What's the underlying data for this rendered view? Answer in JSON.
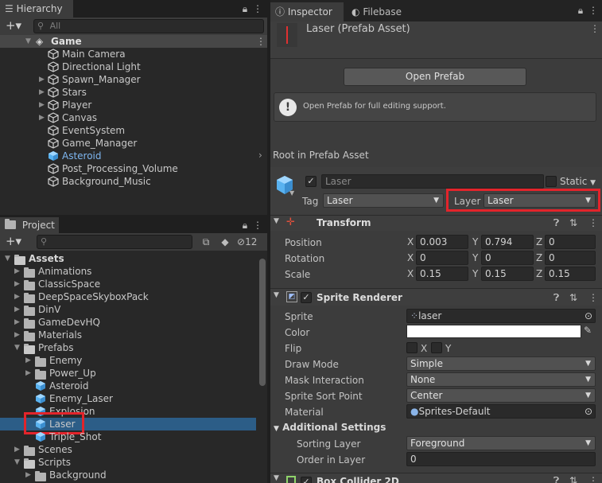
{
  "hierarchy": {
    "tab_label": "Hierarchy",
    "search_placeholder": "All",
    "scene_name": "Game",
    "items": [
      {
        "label": "Main Camera"
      },
      {
        "label": "Directional Light"
      },
      {
        "label": "Spawn_Manager"
      },
      {
        "label": "Stars"
      },
      {
        "label": "Player"
      },
      {
        "label": "Canvas"
      },
      {
        "label": "EventSystem"
      },
      {
        "label": "Game_Manager"
      },
      {
        "label": "Asteroid"
      },
      {
        "label": "Post_Processing_Volume"
      },
      {
        "label": "Background_Music"
      }
    ]
  },
  "project": {
    "tab_label": "Project",
    "hidden_count": "12",
    "root": "Assets",
    "folders": [
      "Animations",
      "ClassicSpace",
      "DeepSpaceSkyboxPack",
      "DinV",
      "GameDevHQ",
      "Materials",
      "Prefabs"
    ],
    "prefab_children": [
      "Enemy",
      "Power_Up",
      "Asteroid",
      "Enemy_Laser",
      "Explosion",
      "Laser",
      "Triple_Shot"
    ],
    "after": [
      "Scenes",
      "Scripts",
      "Background"
    ]
  },
  "inspector": {
    "tab_label": "Inspector",
    "tab2_label": "Filebase",
    "asset_title": "Laser (Prefab Asset)",
    "open_prefab_label": "Open Prefab",
    "info_text": "Open Prefab for full editing support.",
    "root_label": "Root in Prefab Asset",
    "object_name": "Laser",
    "static_label": "Static",
    "tag_label": "Tag",
    "tag_value": "Laser",
    "layer_label": "Layer",
    "layer_value": "Laser",
    "transform": {
      "title": "Transform",
      "position_label": "Position",
      "rotation_label": "Rotation",
      "scale_label": "Scale",
      "position": [
        "0.003",
        "0.794",
        "0"
      ],
      "rotation": [
        "0",
        "0",
        "0"
      ],
      "scale": [
        "0.15",
        "0.15",
        "0.15"
      ],
      "axes": [
        "X",
        "Y",
        "Z"
      ]
    },
    "sprite_renderer": {
      "title": "Sprite Renderer",
      "sprite_label": "Sprite",
      "sprite_value": "laser",
      "color_label": "Color",
      "color_value": "#ffffff",
      "flip_label": "Flip",
      "flip_x": "X",
      "flip_y": "Y",
      "draw_mode_label": "Draw Mode",
      "draw_mode_value": "Simple",
      "mask_label": "Mask Interaction",
      "mask_value": "None",
      "sort_point_label": "Sprite Sort Point",
      "sort_point_value": "Center",
      "material_label": "Material",
      "material_value": "Sprites-Default",
      "additional_label": "Additional Settings",
      "sorting_layer_label": "Sorting Layer",
      "sorting_layer_value": "Foreground",
      "order_label": "Order in Layer",
      "order_value": "0"
    },
    "next_component": "Box Collider 2D"
  },
  "colors": {
    "highlight_box": "#e3242b",
    "selection": "#2c5d87",
    "asteroid_blue": "#7eb6f0"
  }
}
